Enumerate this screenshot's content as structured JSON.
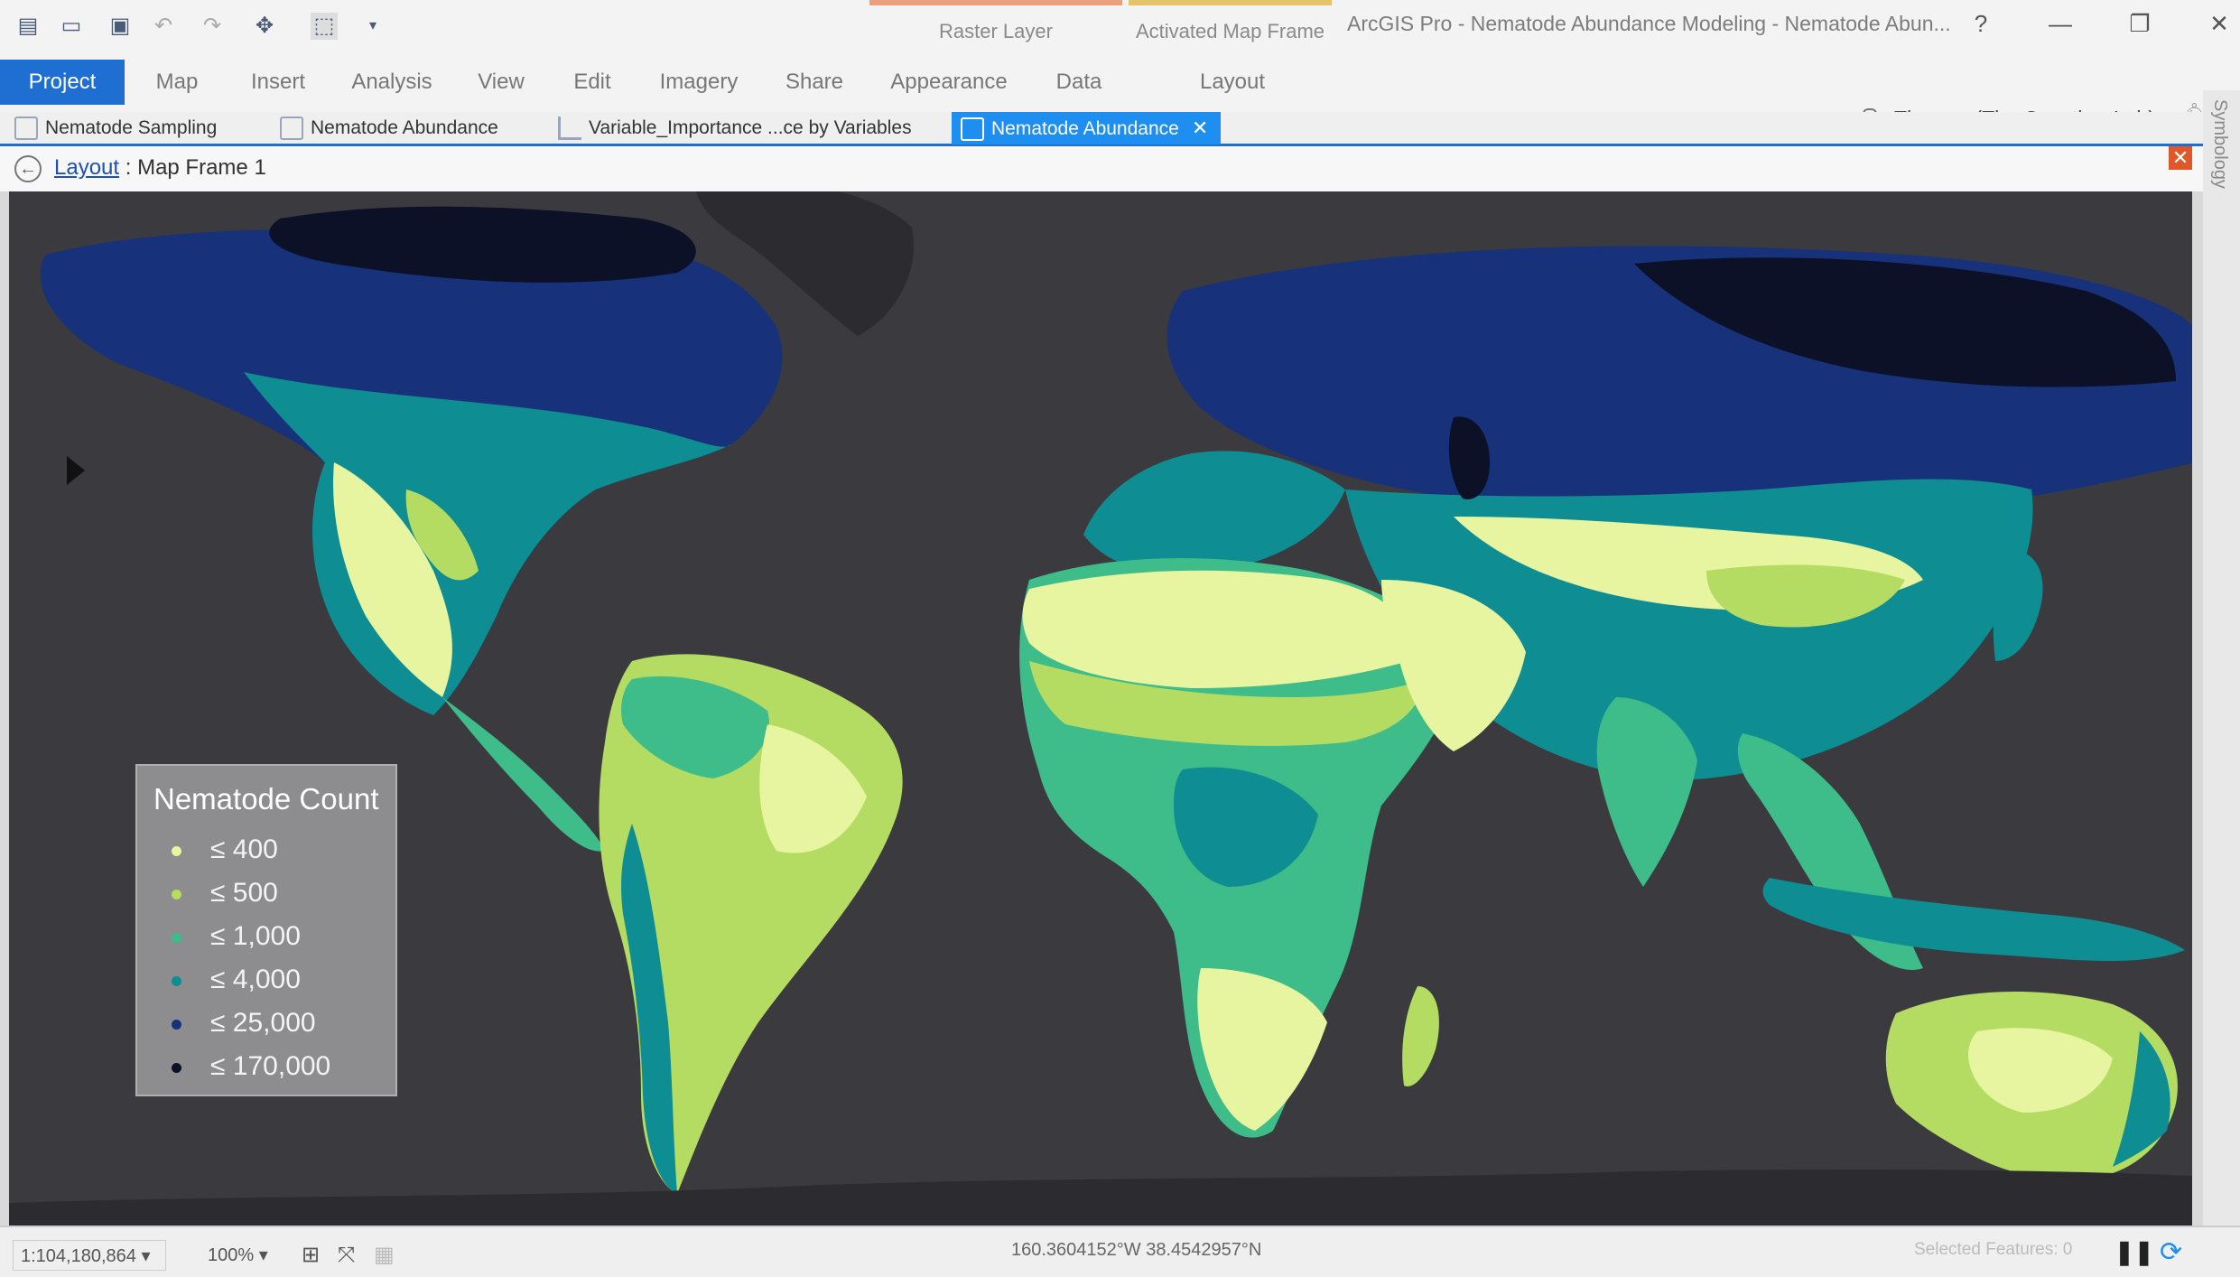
{
  "app": {
    "title": "ArcGIS Pro - Nematode Abundance Modeling - Nematode Abun...",
    "context_tabs": [
      "Raster Layer",
      "Activated Map Frame"
    ],
    "help": "?",
    "minimize": "—",
    "restore": "❐",
    "close": "✕"
  },
  "ribbon": {
    "tabs": [
      "Project",
      "Map",
      "Insert",
      "Analysis",
      "View",
      "Edit",
      "Imagery",
      "Share",
      "Appearance",
      "Data",
      "Layout"
    ],
    "active_tab": "Project",
    "user": "Thomas (The Crowther Lab)"
  },
  "view_tabs": [
    {
      "label": "Nematode Sampling",
      "icon": "map-icon"
    },
    {
      "label": "Nematode Abundance",
      "icon": "map-icon"
    },
    {
      "label": "Variable_Importance ...ce by Variables",
      "icon": "chart-icon"
    },
    {
      "label": "Nematode Abundance",
      "icon": "layout-icon",
      "active": true
    }
  ],
  "breadcrumb": {
    "link": "Layout",
    "separator": " : ",
    "current": "Map Frame 1"
  },
  "side_panel_label": "Symbology",
  "legend": {
    "title": "Nematode Count",
    "items": [
      {
        "label": "≤ 400",
        "color": "#e8f5a0"
      },
      {
        "label": "≤ 500",
        "color": "#b5dc62"
      },
      {
        "label": "≤ 1,000",
        "color": "#3ebc8a"
      },
      {
        "label": "≤ 4,000",
        "color": "#0e8e93"
      },
      {
        "label": "≤ 25,000",
        "color": "#17327a"
      },
      {
        "label": "≤ 170,000",
        "color": "#0c1128"
      }
    ]
  },
  "colors": {
    "ocean": "#3a3a3f",
    "accent": "#1e6fd1"
  },
  "status": {
    "scale": "1:104,180,864",
    "zoom": "100%",
    "coordinates": "160.3604152°W 38.4542957°N",
    "selected_features": "Selected Features: 0"
  }
}
